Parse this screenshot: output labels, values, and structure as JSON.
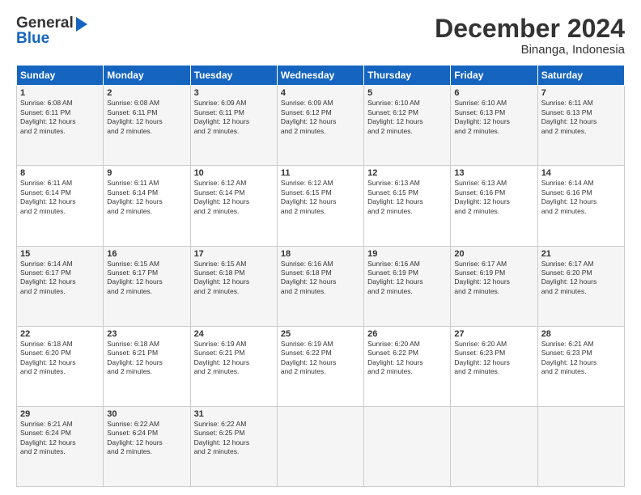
{
  "logo": {
    "line1": "General",
    "line2": "Blue"
  },
  "title": "December 2024",
  "subtitle": "Binanga, Indonesia",
  "days_header": [
    "Sunday",
    "Monday",
    "Tuesday",
    "Wednesday",
    "Thursday",
    "Friday",
    "Saturday"
  ],
  "weeks": [
    [
      {
        "day": "1",
        "info": "Sunrise: 6:08 AM\nSunset: 6:11 PM\nDaylight: 12 hours\nand 2 minutes."
      },
      {
        "day": "2",
        "info": "Sunrise: 6:08 AM\nSunset: 6:11 PM\nDaylight: 12 hours\nand 2 minutes."
      },
      {
        "day": "3",
        "info": "Sunrise: 6:09 AM\nSunset: 6:11 PM\nDaylight: 12 hours\nand 2 minutes."
      },
      {
        "day": "4",
        "info": "Sunrise: 6:09 AM\nSunset: 6:12 PM\nDaylight: 12 hours\nand 2 minutes."
      },
      {
        "day": "5",
        "info": "Sunrise: 6:10 AM\nSunset: 6:12 PM\nDaylight: 12 hours\nand 2 minutes."
      },
      {
        "day": "6",
        "info": "Sunrise: 6:10 AM\nSunset: 6:13 PM\nDaylight: 12 hours\nand 2 minutes."
      },
      {
        "day": "7",
        "info": "Sunrise: 6:11 AM\nSunset: 6:13 PM\nDaylight: 12 hours\nand 2 minutes."
      }
    ],
    [
      {
        "day": "8",
        "info": "Sunrise: 6:11 AM\nSunset: 6:14 PM\nDaylight: 12 hours\nand 2 minutes."
      },
      {
        "day": "9",
        "info": "Sunrise: 6:11 AM\nSunset: 6:14 PM\nDaylight: 12 hours\nand 2 minutes."
      },
      {
        "day": "10",
        "info": "Sunrise: 6:12 AM\nSunset: 6:14 PM\nDaylight: 12 hours\nand 2 minutes."
      },
      {
        "day": "11",
        "info": "Sunrise: 6:12 AM\nSunset: 6:15 PM\nDaylight: 12 hours\nand 2 minutes."
      },
      {
        "day": "12",
        "info": "Sunrise: 6:13 AM\nSunset: 6:15 PM\nDaylight: 12 hours\nand 2 minutes."
      },
      {
        "day": "13",
        "info": "Sunrise: 6:13 AM\nSunset: 6:16 PM\nDaylight: 12 hours\nand 2 minutes."
      },
      {
        "day": "14",
        "info": "Sunrise: 6:14 AM\nSunset: 6:16 PM\nDaylight: 12 hours\nand 2 minutes."
      }
    ],
    [
      {
        "day": "15",
        "info": "Sunrise: 6:14 AM\nSunset: 6:17 PM\nDaylight: 12 hours\nand 2 minutes."
      },
      {
        "day": "16",
        "info": "Sunrise: 6:15 AM\nSunset: 6:17 PM\nDaylight: 12 hours\nand 2 minutes."
      },
      {
        "day": "17",
        "info": "Sunrise: 6:15 AM\nSunset: 6:18 PM\nDaylight: 12 hours\nand 2 minutes."
      },
      {
        "day": "18",
        "info": "Sunrise: 6:16 AM\nSunset: 6:18 PM\nDaylight: 12 hours\nand 2 minutes."
      },
      {
        "day": "19",
        "info": "Sunrise: 6:16 AM\nSunset: 6:19 PM\nDaylight: 12 hours\nand 2 minutes."
      },
      {
        "day": "20",
        "info": "Sunrise: 6:17 AM\nSunset: 6:19 PM\nDaylight: 12 hours\nand 2 minutes."
      },
      {
        "day": "21",
        "info": "Sunrise: 6:17 AM\nSunset: 6:20 PM\nDaylight: 12 hours\nand 2 minutes."
      }
    ],
    [
      {
        "day": "22",
        "info": "Sunrise: 6:18 AM\nSunset: 6:20 PM\nDaylight: 12 hours\nand 2 minutes."
      },
      {
        "day": "23",
        "info": "Sunrise: 6:18 AM\nSunset: 6:21 PM\nDaylight: 12 hours\nand 2 minutes."
      },
      {
        "day": "24",
        "info": "Sunrise: 6:19 AM\nSunset: 6:21 PM\nDaylight: 12 hours\nand 2 minutes."
      },
      {
        "day": "25",
        "info": "Sunrise: 6:19 AM\nSunset: 6:22 PM\nDaylight: 12 hours\nand 2 minutes."
      },
      {
        "day": "26",
        "info": "Sunrise: 6:20 AM\nSunset: 6:22 PM\nDaylight: 12 hours\nand 2 minutes."
      },
      {
        "day": "27",
        "info": "Sunrise: 6:20 AM\nSunset: 6:23 PM\nDaylight: 12 hours\nand 2 minutes."
      },
      {
        "day": "28",
        "info": "Sunrise: 6:21 AM\nSunset: 6:23 PM\nDaylight: 12 hours\nand 2 minutes."
      }
    ],
    [
      {
        "day": "29",
        "info": "Sunrise: 6:21 AM\nSunset: 6:24 PM\nDaylight: 12 hours\nand 2 minutes."
      },
      {
        "day": "30",
        "info": "Sunrise: 6:22 AM\nSunset: 6:24 PM\nDaylight: 12 hours\nand 2 minutes."
      },
      {
        "day": "31",
        "info": "Sunrise: 6:22 AM\nSunset: 6:25 PM\nDaylight: 12 hours\nand 2 minutes."
      },
      {
        "day": "",
        "info": ""
      },
      {
        "day": "",
        "info": ""
      },
      {
        "day": "",
        "info": ""
      },
      {
        "day": "",
        "info": ""
      }
    ]
  ]
}
